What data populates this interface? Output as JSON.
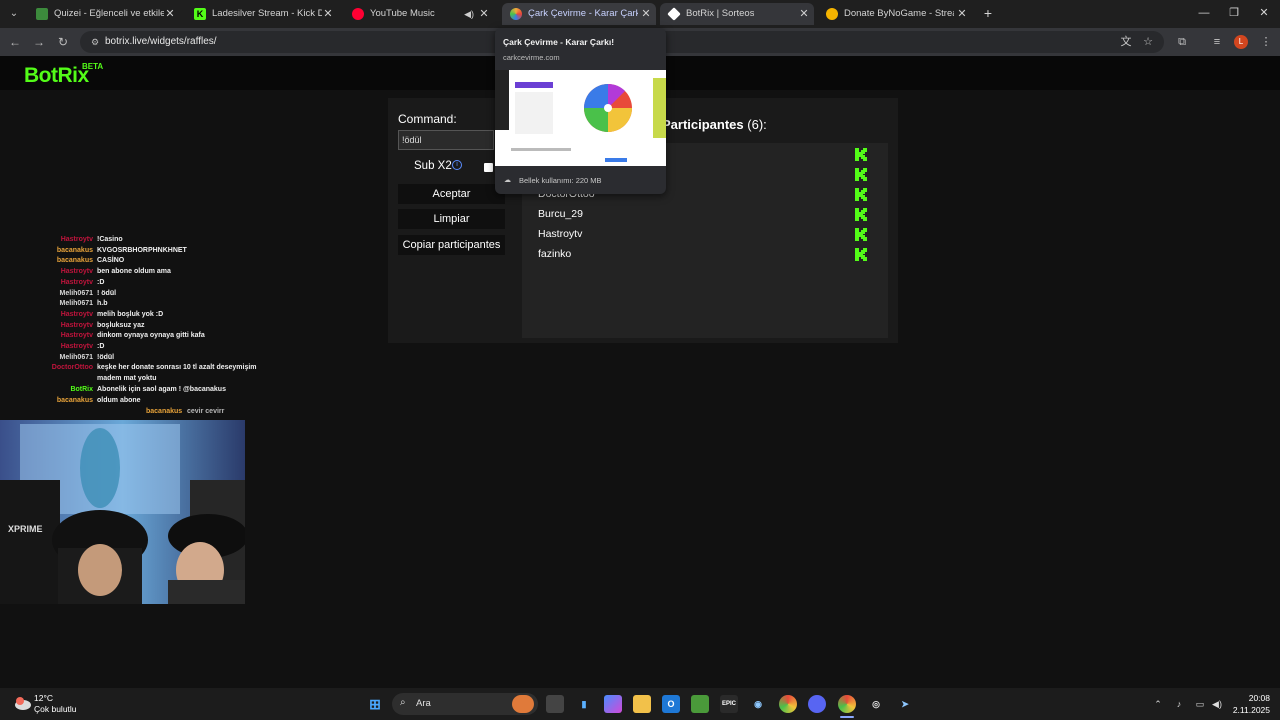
{
  "browser": {
    "tabs": [
      {
        "title": "Quizei - Eğlenceli ve etkileşimli",
        "favicon": "quizei-icon",
        "color": "#3c8a3c"
      },
      {
        "title": "Ladesilver Stream - Kick Dashb",
        "favicon": "kick-icon",
        "color": "#53fc18"
      },
      {
        "title": "YouTube Music",
        "favicon": "youtube-music-icon",
        "color": "#ff0033"
      },
      {
        "title": "Çark Çevirme - Karar Çarkı!",
        "favicon": "wheel-icon",
        "color": "#f2a93b"
      },
      {
        "title": "BotRix | Sorteos",
        "favicon": "botrix-icon",
        "color": "#ffffff"
      },
      {
        "title": "Donate ByNoGame - Streamer",
        "favicon": "bynogame-icon",
        "color": "#f5b400"
      }
    ],
    "url": "botrix.live/widgets/raffles/"
  },
  "hovercard": {
    "title": "Çark Çevirme - Karar Çarkı!",
    "domain": "carkcevirme.com",
    "memory": "Bellek kullanımı: 220 MB"
  },
  "site": {
    "logo": "BotRix",
    "logo_badge": "BETA"
  },
  "raffle": {
    "command_label": "Command:",
    "command_value": "!ödül",
    "sub_label": "Sub X2",
    "accept_label": "Aceptar",
    "clear_label": "Limpiar",
    "copy_label": "Copiar participantes",
    "participants_heading": "Participantes",
    "participants_count": "(6):",
    "participants": [
      "",
      "",
      "DoctorOttoo",
      "Burcu_29",
      "Hastroytv",
      "fazinko"
    ],
    "accent": "#53fc18"
  },
  "chat": [
    {
      "user": "Hastroytv",
      "msg": "!Casino",
      "color": "#c0143c"
    },
    {
      "user": "bacanakus",
      "msg": "KVGOSRBHORPHNKHNET",
      "color": "#e8a33a"
    },
    {
      "user": "bacanakus",
      "msg": "CASİNO",
      "color": "#e8a33a"
    },
    {
      "user": "Hastroytv",
      "msg": "ben abone oldum ama",
      "color": "#c0143c"
    },
    {
      "user": "Hastroytv",
      "msg": ":D",
      "color": "#c0143c"
    },
    {
      "user": "Melih0671",
      "msg": "! ödül",
      "color": "#d8d8d8"
    },
    {
      "user": "Melih0671",
      "msg": "h.b",
      "color": "#d8d8d8"
    },
    {
      "user": "Hastroytv",
      "msg": "melih boşluk yok :D",
      "color": "#c0143c"
    },
    {
      "user": "Hastroytv",
      "msg": "boşluksuz yaz",
      "color": "#c0143c"
    },
    {
      "user": "Hastroytv",
      "msg": "dinkom oynaya oynaya gitti kafa",
      "color": "#c0143c"
    },
    {
      "user": "Hastroytv",
      "msg": ":D",
      "color": "#c0143c"
    },
    {
      "user": "Melih0671",
      "msg": "!ödül",
      "color": "#d8d8d8"
    },
    {
      "user": "DoctorOttoo",
      "msg": "keşke her donate sonrası 10 tl azalt deseymişim",
      "color": "#c0143c"
    },
    {
      "user": "",
      "msg": "madem mat yoktu",
      "color": "#c0143c"
    },
    {
      "user": "BotRix",
      "msg": "Abonelik için saol agam ! @bacanakus",
      "color": "#53fc18"
    },
    {
      "user": "bacanakus",
      "msg": "oldum abone",
      "color": "#e8a33a"
    }
  ],
  "chat_tail": {
    "user": "bacanakus",
    "msg": "cevir cevirr",
    "color": "#e8a33a"
  },
  "taskbar": {
    "weather_temp": "12°C",
    "weather_desc": "Çok bulutlu",
    "search_placeholder": "Ara",
    "time": "20:08",
    "date": "2.11.2025"
  }
}
